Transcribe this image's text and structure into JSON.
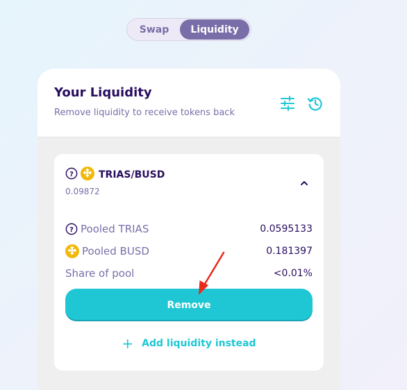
{
  "tabs": {
    "swap": "Swap",
    "liquidity": "Liquidity"
  },
  "card": {
    "title": "Your Liquidity",
    "subtitle": "Remove liquidity to receive tokens back"
  },
  "position": {
    "pair": "TRIAS/BUSD",
    "amount": "0.09872",
    "rows": [
      {
        "label": "Pooled TRIAS",
        "value": "0.0595133",
        "icon": "question-icon"
      },
      {
        "label": "Pooled BUSD",
        "value": "0.181397",
        "icon": "busd-icon"
      },
      {
        "label": "Share of pool",
        "value": "<0.01%"
      }
    ],
    "remove_label": "Remove",
    "add_label": "Add liquidity instead",
    "add_icon": "+"
  },
  "colors": {
    "primary": "#1fc7d4",
    "secondary": "#7a6eaa",
    "text": "#280d5f",
    "busd": "#f0b90b",
    "annotation_arrow": "#e8291c"
  }
}
